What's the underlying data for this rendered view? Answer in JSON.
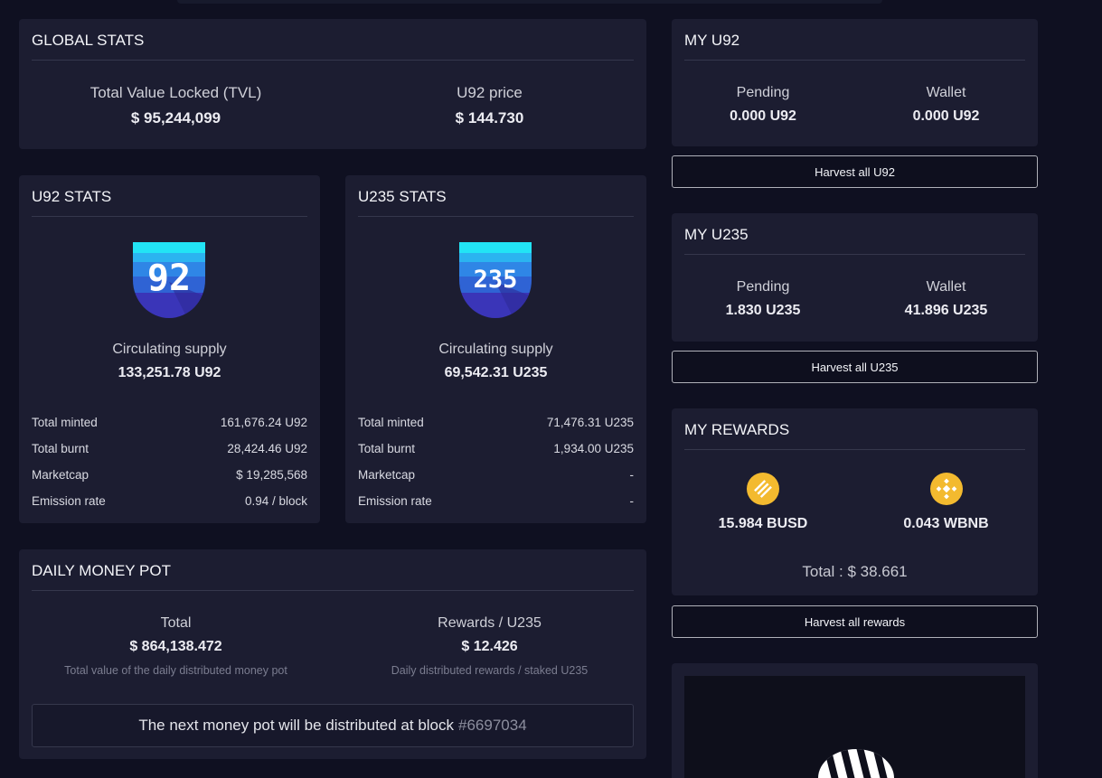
{
  "global_stats": {
    "title": "GLOBAL STATS",
    "tvl_label": "Total Value Locked (TVL)",
    "tvl_value": "$ 95,244,099",
    "price_label": "U92 price",
    "price_value": "$ 144.730"
  },
  "u92_stats": {
    "title": "U92 STATS",
    "logo_text": "92",
    "supply_label": "Circulating supply",
    "supply_value": "133,251.78 U92",
    "rows": [
      {
        "k": "Total minted",
        "v": "161,676.24 U92"
      },
      {
        "k": "Total burnt",
        "v": "28,424.46 U92"
      },
      {
        "k": "Marketcap",
        "v": "$ 19,285,568"
      },
      {
        "k": "Emission rate",
        "v": "0.94 / block"
      }
    ]
  },
  "u235_stats": {
    "title": "U235 STATS",
    "logo_text": "235",
    "supply_label": "Circulating supply",
    "supply_value": "69,542.31 U235",
    "rows": [
      {
        "k": "Total minted",
        "v": "71,476.31 U235"
      },
      {
        "k": "Total burnt",
        "v": "1,934.00 U235"
      },
      {
        "k": "Marketcap",
        "v": "-"
      },
      {
        "k": "Emission rate",
        "v": "-"
      }
    ]
  },
  "money_pot": {
    "title": "DAILY MONEY POT",
    "total_label": "Total",
    "total_value": "$ 864,138.472",
    "total_note": "Total value of the daily distributed money pot",
    "rewards_label": "Rewards / U235",
    "rewards_value": "$ 12.426",
    "rewards_note": "Daily distributed rewards / staked U235",
    "notice_text": "The next money pot will be distributed at block",
    "notice_block": "#6697034"
  },
  "my_u92": {
    "title": "MY U92",
    "pending_label": "Pending",
    "pending_value": "0.000 U92",
    "wallet_label": "Wallet",
    "wallet_value": "0.000 U92",
    "button": "Harvest all U92"
  },
  "my_u235": {
    "title": "MY U235",
    "pending_label": "Pending",
    "pending_value": "1.830 U235",
    "wallet_label": "Wallet",
    "wallet_value": "41.896 U235",
    "button": "Harvest all U235"
  },
  "my_rewards": {
    "title": "MY REWARDS",
    "busd_value": "15.984 BUSD",
    "busd_icon": "busd-coin-icon",
    "wbnb_value": "0.043 WBNB",
    "wbnb_icon": "bnb-coin-icon",
    "total": "Total : $ 38.661",
    "button": "Harvest all rewards"
  },
  "colors": {
    "background": "#0f1021",
    "card": "#1c1d31",
    "coin": "#f3ba2f",
    "logo_top": "#22e4f5",
    "logo_mid": "#2f7fe0",
    "logo_bottom": "#3a35b8"
  }
}
